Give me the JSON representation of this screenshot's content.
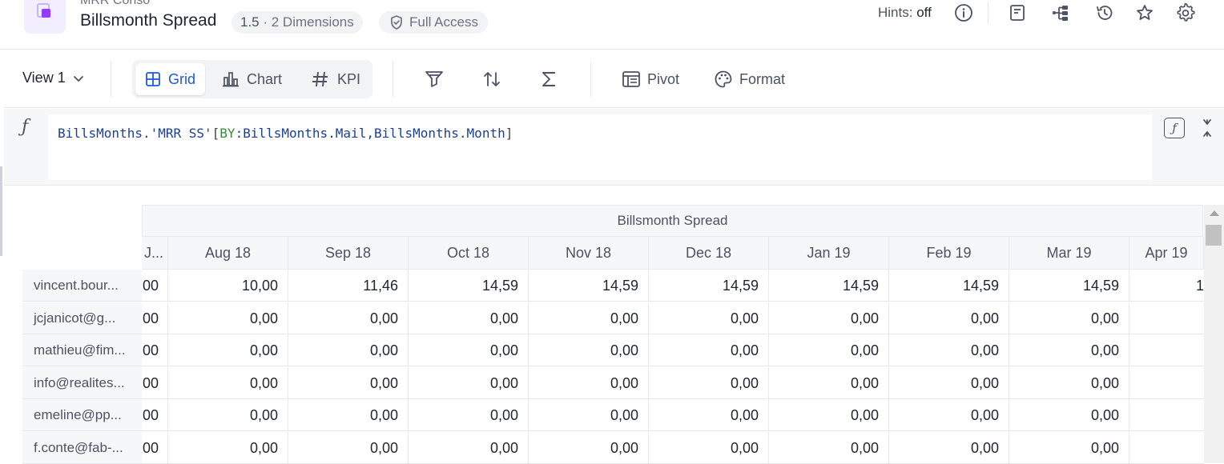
{
  "header": {
    "breadcrumb": "MRR Conso",
    "title": "Billsmonth Spread",
    "version": "1.5",
    "dimensions": "· 2 Dimensions",
    "access": "Full Access",
    "hints_label": "Hints:",
    "hints_value": "off"
  },
  "toolbar": {
    "view_label": "View 1",
    "tabs": [
      {
        "label": "Grid",
        "icon": "grid-icon"
      },
      {
        "label": "Chart",
        "icon": "bar-chart-icon"
      },
      {
        "label": "KPI",
        "icon": "hash-icon"
      }
    ],
    "pivot_label": "Pivot",
    "format_label": "Format"
  },
  "formula": {
    "part1": "BillsMonths.'MRR SS'",
    "part2": "[",
    "keyword": "BY",
    "part3": ":BillsMonths.Mail,BillsMonths.Month",
    "part4": "]"
  },
  "grid": {
    "title": "Billsmonth Spread",
    "partial_column_header": "J...",
    "columns": [
      "Aug 18",
      "Sep 18",
      "Oct 18",
      "Nov 18",
      "Dec 18",
      "Jan 19",
      "Feb 19",
      "Mar 19",
      "Apr 19"
    ],
    "rows": [
      {
        "label": "vincent.bour...",
        "partial": "00",
        "values": [
          "10,00",
          "11,46",
          "14,59",
          "14,59",
          "14,59",
          "14,59",
          "14,59",
          "14,59",
          "1"
        ]
      },
      {
        "label": "jcjanicot@g...",
        "partial": "00",
        "values": [
          "0,00",
          "0,00",
          "0,00",
          "0,00",
          "0,00",
          "0,00",
          "0,00",
          "0,00",
          ""
        ]
      },
      {
        "label": "mathieu@fim...",
        "partial": "00",
        "values": [
          "0,00",
          "0,00",
          "0,00",
          "0,00",
          "0,00",
          "0,00",
          "0,00",
          "0,00",
          ""
        ]
      },
      {
        "label": "info@realites...",
        "partial": "00",
        "values": [
          "0,00",
          "0,00",
          "0,00",
          "0,00",
          "0,00",
          "0,00",
          "0,00",
          "0,00",
          ""
        ]
      },
      {
        "label": "emeline@pp...",
        "partial": "00",
        "values": [
          "0,00",
          "0,00",
          "0,00",
          "0,00",
          "0,00",
          "0,00",
          "0,00",
          "0,00",
          ""
        ]
      },
      {
        "label": "f.conte@fab-...",
        "partial": "00",
        "values": [
          "0,00",
          "0,00",
          "0,00",
          "0,00",
          "0,00",
          "0,00",
          "0,00",
          "0,00",
          ""
        ]
      }
    ]
  },
  "colors": {
    "accent": "#1e5bd6",
    "app_icon": "#8f3dfa",
    "formula_keyword": "#3a8a3a",
    "formula_text": "#1c3f8f"
  }
}
